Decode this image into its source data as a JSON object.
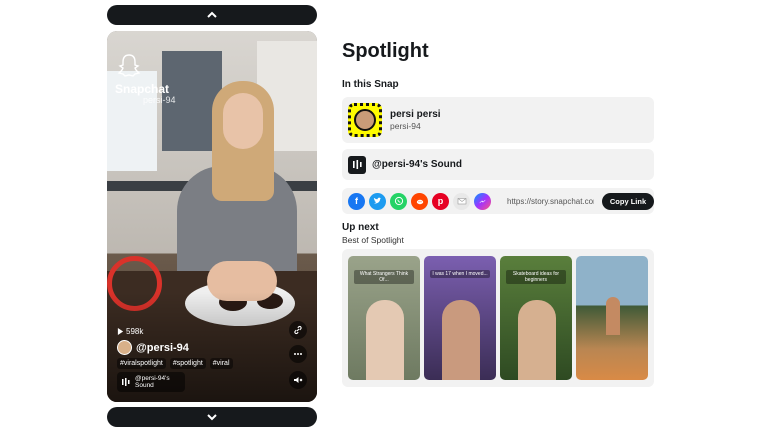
{
  "player": {
    "brand": "Snapchat",
    "overlay_user": "persi-94",
    "views": "598k",
    "author": "@persi-94",
    "tags": [
      "#viralspotlight",
      "#spotlight",
      "#viral"
    ],
    "sound_chip": "@persi-94's Sound"
  },
  "page": {
    "title": "Spotlight",
    "in_this_snap": "In this Snap",
    "creator": {
      "name": "persi persi",
      "username": "persi-94"
    },
    "sound_label": "@persi-94's Sound",
    "share": {
      "link": "https://story.snapchat.com/",
      "copy_label": "Copy Link",
      "icons": [
        "facebook-icon",
        "twitter-icon",
        "whatsapp-icon",
        "reddit-icon",
        "pinterest-icon",
        "email-icon",
        "messenger-icon"
      ]
    },
    "up_next": "Up next",
    "up_next_sub": "Best of Spotlight",
    "thumbnails": [
      {
        "caption": "What Strangers Think Of..."
      },
      {
        "caption": "I was 17 when I moved..."
      },
      {
        "caption": "Skateboard ideas for beginners"
      },
      {
        "caption": ""
      }
    ]
  },
  "colors": {
    "accent_dark": "#16191c",
    "snap_yellow": "#fffc00",
    "card_bg": "#f2f2f2"
  }
}
